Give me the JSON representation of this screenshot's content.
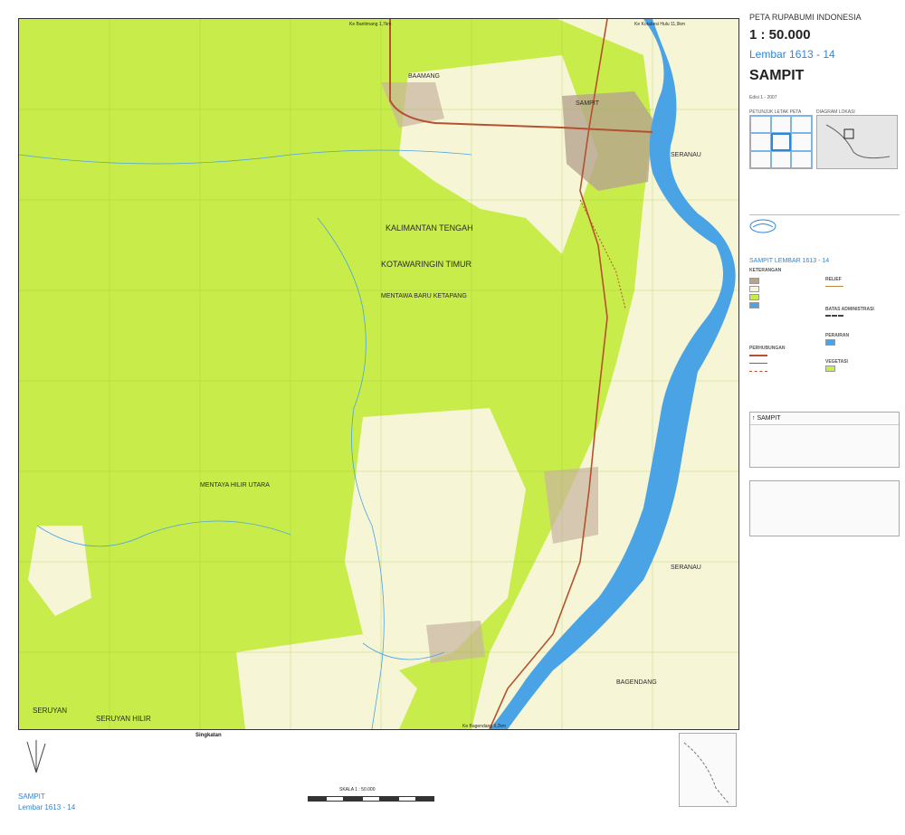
{
  "header": {
    "series": "PETA RUPABUMI INDONESIA",
    "scale": "1 : 50.000",
    "sheet": "Lembar 1613 - 14",
    "title": "SAMPIT",
    "edition": "Edisi 1 - 2007",
    "index_label": "PETUNJUK LETAK PETA",
    "diagram_label": "DIAGRAM LOKASI"
  },
  "map": {
    "top_road_left": "Ke Bantimang 1,7km",
    "top_road_right": "Ke Kotabesi Hulu 11,9km",
    "bottom_road": "Ke Bagendang 6,2km",
    "places": [
      {
        "label": "BAAMANG"
      },
      {
        "label": "SAMPIT"
      },
      {
        "label": "SERANAU"
      },
      {
        "label": "KALIMANTAN TENGAH"
      },
      {
        "label": "KOTAWARINGIN TIMUR"
      },
      {
        "label": "MENTAWA BARU KETAPANG"
      },
      {
        "label": "MENTAYA HILIR UTARA"
      },
      {
        "label": "SERANAU"
      },
      {
        "label": "BAGENDANG"
      },
      {
        "label": "SERUYAN"
      },
      {
        "label": "SERUYAN HILIR"
      }
    ]
  },
  "legend": {
    "heading": "KETERANGAN",
    "sheet_label": "SAMPIT LEMBAR 1613 - 14",
    "categories": [
      "RELIEF",
      "PERHUBUNGAN",
      "BATAS ADMINISTRASI",
      "PERAIRAN",
      "VEGETASI"
    ]
  },
  "bottom": {
    "scale_text": "SKALA 1 : 50.000",
    "singkatan_title": "Singkatan",
    "sheet_name": "SAMPIT",
    "sheet_number": "Lembar 1613 - 14"
  },
  "colors": {
    "vegetation": "#c8ec4a",
    "cleared": "#f6f6d6",
    "urban": "#b7a48e",
    "river": "#4aa3e4",
    "road": "#b5512e"
  }
}
